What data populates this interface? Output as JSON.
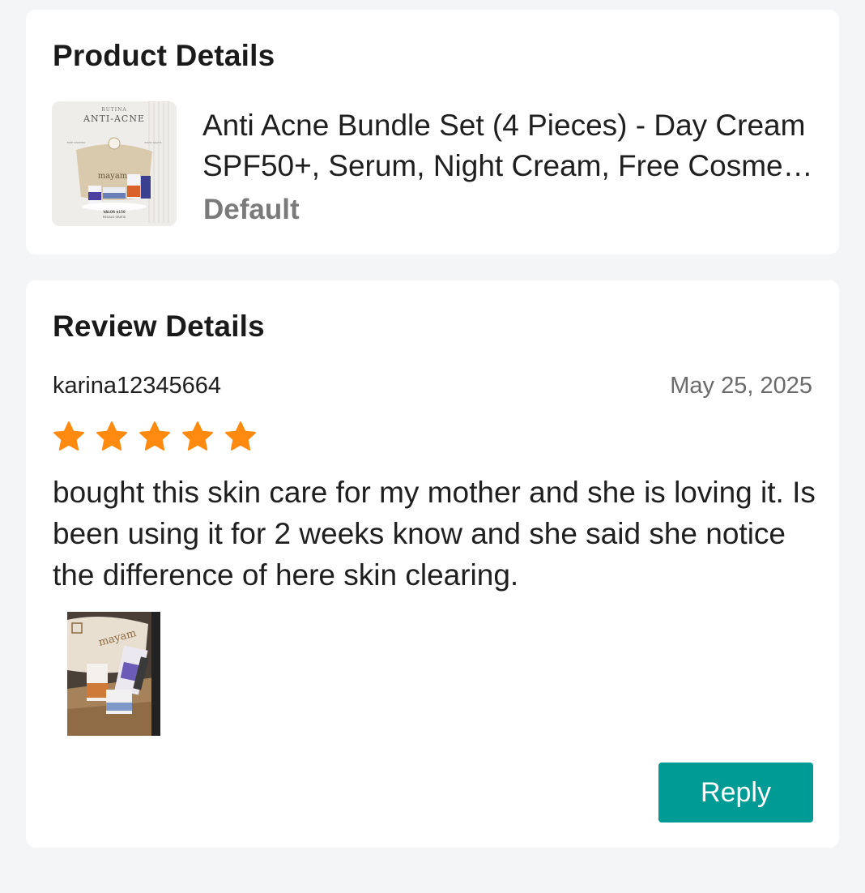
{
  "product_section": {
    "title": "Product Details",
    "product_name": "Anti Acne Bundle Set (4 Pieces) - Day Cream SPF50+, Serum, Night Cream, Free Cosmetic Bag",
    "variant": "Default",
    "thumbnail_text": {
      "line1": "RUTINA",
      "line2": "ANTI-ACNE",
      "brand": "mayam",
      "left_tag": "FREE SHIPPING",
      "right_tag": "ENVIO GRATIS",
      "value": "VALOR $150",
      "gift": "REGALO GRATIS"
    }
  },
  "review_section": {
    "title": "Review Details",
    "reviewer": "karina12345664",
    "date": "May 25, 2025",
    "rating": 5,
    "rating_max": 5,
    "star_color": "#ff8a0f",
    "text": "bought this skin care for my mother and she is loving it. Is been using it for 2 weeks know and she said she notice the difference of here skin clearing.",
    "photo_brand": "mayam",
    "reply_label": "Reply",
    "reply_color": "#009b94"
  }
}
